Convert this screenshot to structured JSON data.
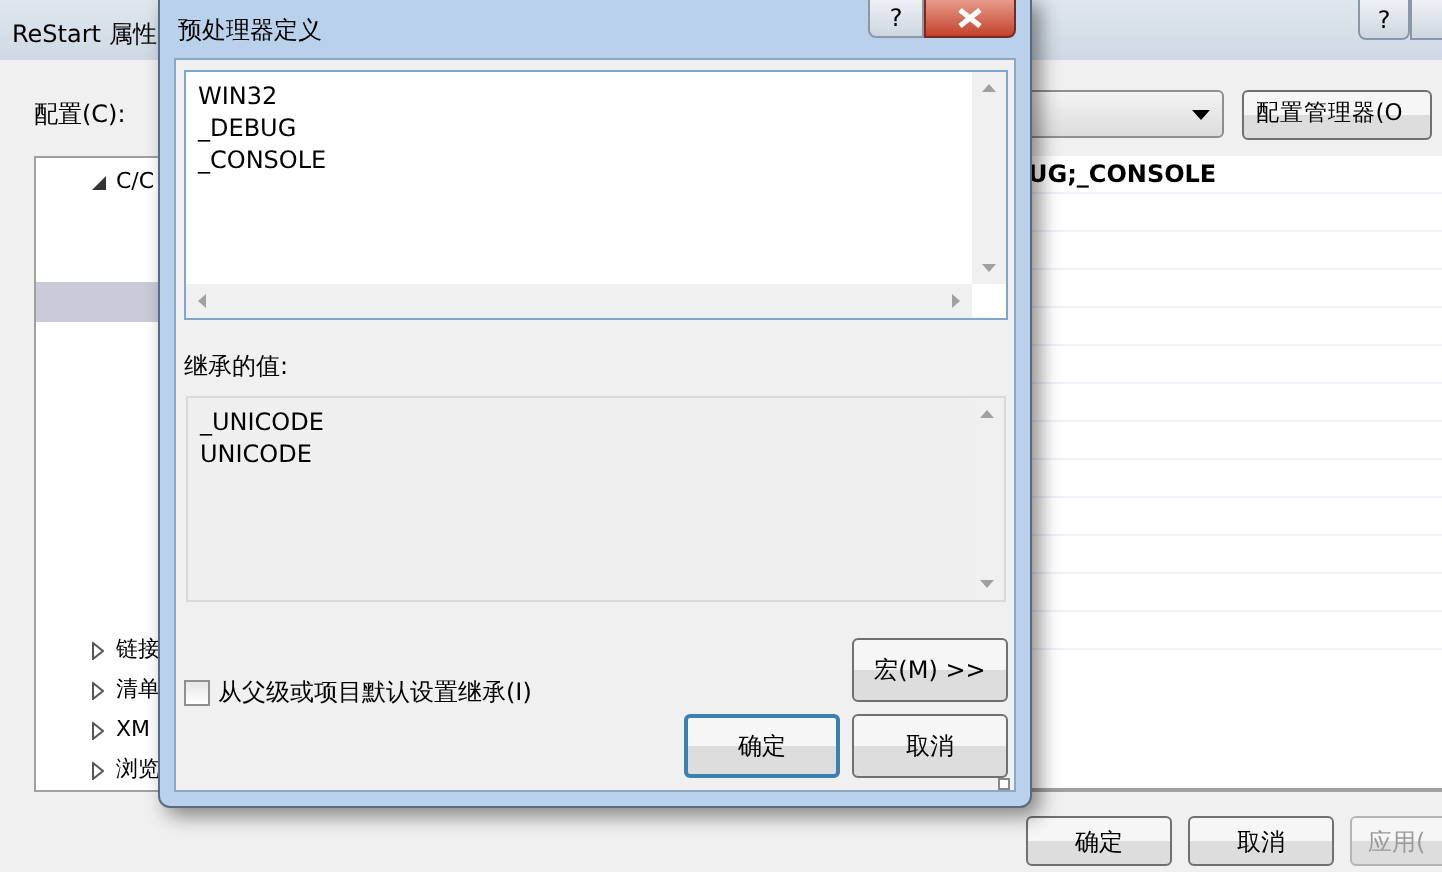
{
  "background_window": {
    "title": "ReStart 属性",
    "help_button": "?",
    "config_label": "配置(C):",
    "config_manager_button": "配置管理器(O",
    "tree": [
      {
        "label": "C/C",
        "expanded": true,
        "children": [
          {
            "selected": true
          }
        ]
      },
      {
        "label": "链接",
        "expanded": false
      },
      {
        "label": "清单",
        "expanded": false
      },
      {
        "label": "XM",
        "expanded": false
      },
      {
        "label": "浏览",
        "expanded": false
      }
    ],
    "grid_rows": [
      "UG;_CONSOLE"
    ],
    "buttons": [
      {
        "label": "确定",
        "disabled": false
      },
      {
        "label": "取消",
        "disabled": false
      },
      {
        "label": "应用(",
        "disabled": true
      }
    ]
  },
  "dialog": {
    "title": "预处理器定义",
    "help_button": "?",
    "definitions": [
      "WIN32",
      "_DEBUG",
      "_CONSOLE"
    ],
    "inherited_label": "继承的值:",
    "inherited_values": [
      "_UNICODE",
      "UNICODE"
    ],
    "inherit_checkbox": {
      "label": "从父级或项目默认设置继承(I)",
      "checked": false
    },
    "macro_button": "宏(M) >>",
    "buttons": [
      {
        "label": "确定",
        "default": true
      },
      {
        "label": "取消",
        "default": false
      }
    ]
  }
}
